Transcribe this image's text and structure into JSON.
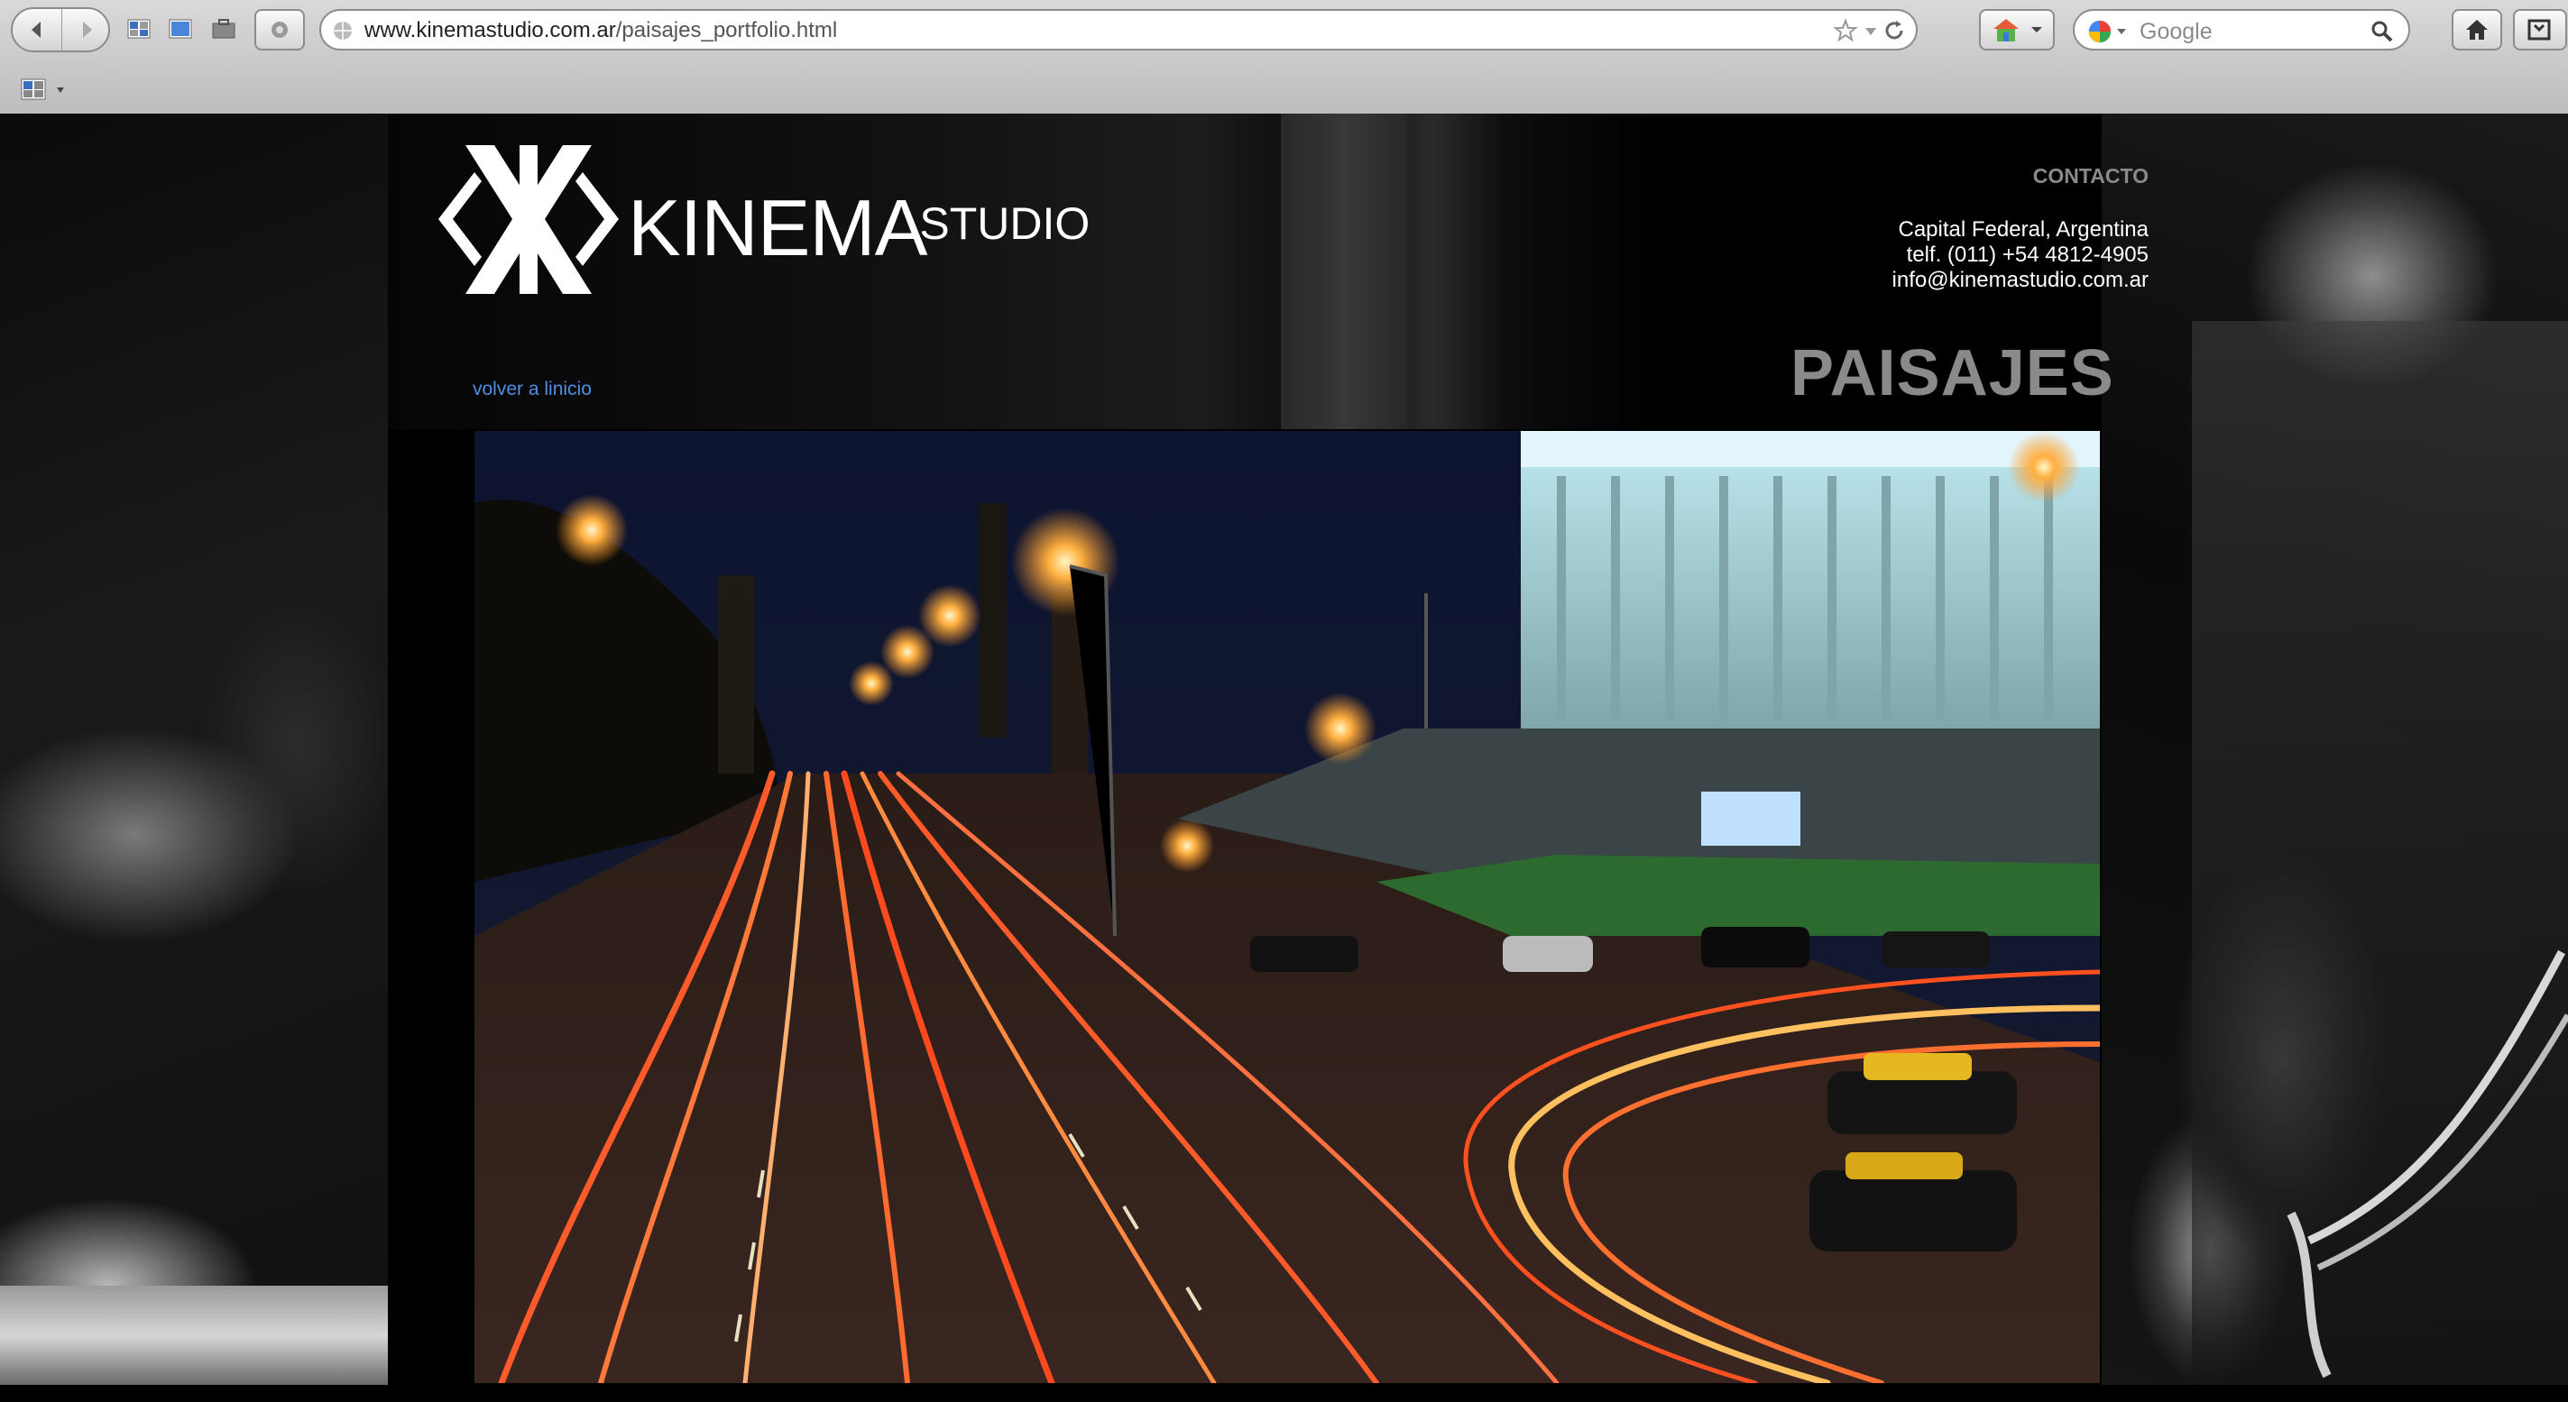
{
  "browser": {
    "url_host": "www.kinemastudio.com.ar",
    "url_path": "/paisajes_portfolio.html",
    "search_placeholder": "Google"
  },
  "site": {
    "logo_main": "KINEMA",
    "logo_suffix": "STUDIO",
    "contact": {
      "heading": "CONTACTO",
      "address": "Capital Federal, Argentina",
      "phone": "telf. (011) +54 4812-4905",
      "email": "info@kinemastudio.com.ar"
    },
    "back_link": "volver a linicio",
    "section_title": "PAISAJES"
  },
  "colors": {
    "link": "#4f8fe0",
    "heading_gray": "#8a8a8a"
  }
}
